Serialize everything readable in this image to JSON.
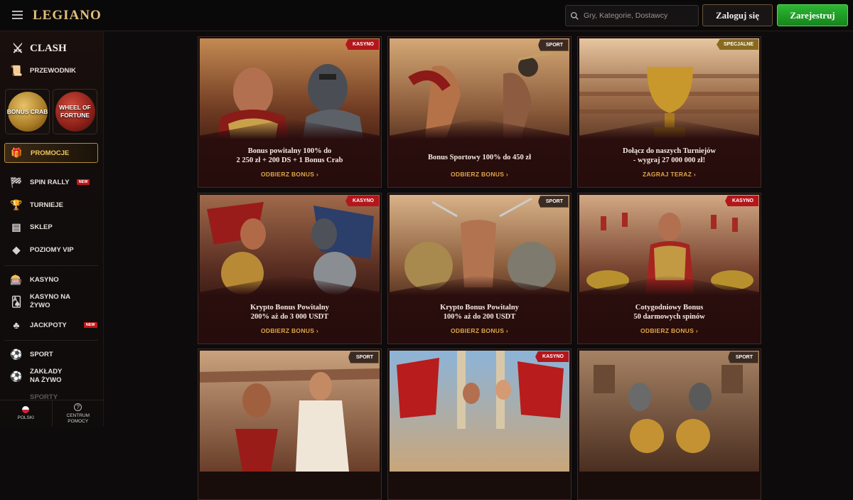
{
  "header": {
    "logo": "LEGIANO",
    "search_placeholder": "Gry, Kategorie, Dostawcy",
    "login_label": "Zaloguj się",
    "register_label": "Zarejestruj"
  },
  "sidebar": {
    "clash_label": "CLASH",
    "guide_label": "PRZEWODNIK",
    "bonus_crab_label": "BONUS CRAB",
    "wheel_label": "WHEEL OF FORTUNE",
    "promotions_label": "PROMOCJE",
    "spin_rally_label": "SPIN RALLY",
    "new_badge": "NEW",
    "tournaments_label": "TURNIEJE",
    "shop_label": "SKLEP",
    "vip_label": "POZIOMY VIP",
    "casino_label": "KASYNO",
    "live_casino_label": "KASYNO NA ŻYWO",
    "jackpots_label": "JACKPOTY",
    "sport_label": "SPORT",
    "live_bets_label": "ZAKŁADY NA ŻYWO",
    "sports_cut_label": "SPORTY",
    "language_label": "POLSKI",
    "help_label": "CENTRUM POMOCY"
  },
  "cards": [
    {
      "tag": "KASYNO",
      "tag_type": "kasyno",
      "title_line1": "Bonus powitalny 100% do",
      "title_line2": "2 250 zł + 200 DS + 1 Bonus Crab",
      "cta": "ODBIERZ BONUS"
    },
    {
      "tag": "SPORT",
      "tag_type": "sport",
      "title_line1": "Bonus Sportowy 100% do 450 zł",
      "title_line2": "",
      "cta": "ODBIERZ BONUS"
    },
    {
      "tag": "SPECJALNE",
      "tag_type": "specjalne",
      "title_line1": "Dołącz do naszych Turniejów",
      "title_line2": "- wygraj 27 000 000 zł!",
      "cta": "ZAGRAJ TERAZ"
    },
    {
      "tag": "KASYNO",
      "tag_type": "kasyno",
      "title_line1": "Krypto Bonus Powitalny",
      "title_line2": "200% aż do 3 000 USDT",
      "cta": "ODBIERZ BONUS"
    },
    {
      "tag": "SPORT",
      "tag_type": "sport",
      "title_line1": "Krypto Bonus Powitalny",
      "title_line2": "100% aż do 200 USDT",
      "cta": "ODBIERZ BONUS"
    },
    {
      "tag": "KASYNO",
      "tag_type": "kasyno",
      "title_line1": "Cotygodniowy Bonus",
      "title_line2": "50 darmowych spinów",
      "cta": "ODBIERZ BONUS"
    },
    {
      "tag": "SPORT",
      "tag_type": "sport",
      "title_line1": "",
      "title_line2": "",
      "cta": ""
    },
    {
      "tag": "KASYNO",
      "tag_type": "kasyno",
      "title_line1": "",
      "title_line2": "",
      "cta": ""
    },
    {
      "tag": "SPORT",
      "tag_type": "sport",
      "title_line1": "",
      "title_line2": "",
      "cta": ""
    }
  ],
  "colors": {
    "accent_gold": "#e0a74a",
    "register_green": "#1f9e26",
    "kasyno_red": "#b3161b"
  }
}
